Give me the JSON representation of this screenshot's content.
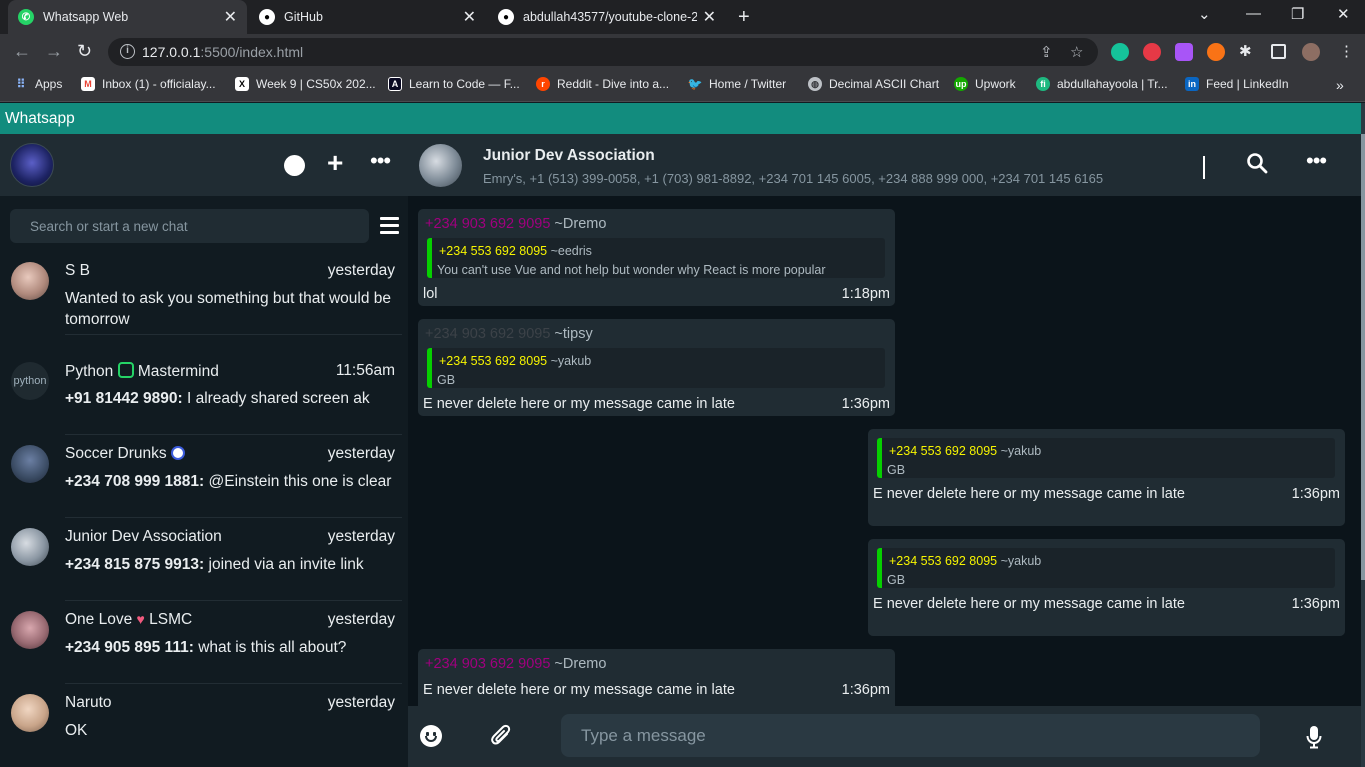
{
  "browser": {
    "tabs": [
      {
        "title": "Whatsapp Web",
        "close": "✕"
      },
      {
        "title": "GitHub",
        "close": "✕"
      },
      {
        "title": "abdullah43577/youtube-clone-2022",
        "close": "✕"
      }
    ],
    "new_tab": "+",
    "url_host": "127.0.0.1",
    "url_rest": ":5500/index.html",
    "bookmarks": [
      {
        "label": "Apps",
        "icon": "apps-grid-icon",
        "color": "#e8eaed"
      },
      {
        "label": "Inbox (1) - officialay...",
        "icon": "gmail-icon",
        "color": "#ea4335"
      },
      {
        "label": "Week 9 | CS50x 202...",
        "icon": "cs50-icon",
        "color": "#000000"
      },
      {
        "label": "Learn to Code — F...",
        "icon": "freecodecamp-icon",
        "color": "#0a0a23"
      },
      {
        "label": "Reddit - Dive into a...",
        "icon": "reddit-icon",
        "color": "#ff4500"
      },
      {
        "label": "Home / Twitter",
        "icon": "twitter-icon",
        "color": "#1d9bf0"
      },
      {
        "label": "Decimal ASCII Chart",
        "icon": "globe-icon",
        "color": "#bdc1c6"
      },
      {
        "label": "Upwork",
        "icon": "upwork-icon",
        "color": "#14a800"
      },
      {
        "label": "abdullahayoola | Tr...",
        "icon": "tr-icon",
        "color": "#1eb980"
      },
      {
        "label": "Feed | LinkedIn",
        "icon": "linkedin-icon",
        "color": "#0a66c2"
      }
    ]
  },
  "app": {
    "title": "Whatsapp",
    "search_placeholder": "Search or start a new chat",
    "chats": [
      {
        "name": "S B",
        "time": "yesterday",
        "sender": "",
        "preview": "Wanted to ask you something but that would be tomorrow",
        "avatar_color": "#c9a79b"
      },
      {
        "name": "Python",
        "name_suffix": "Mastermind",
        "name_emoji": "python-emoji-icon",
        "time": "11:56am",
        "sender": "+91 81442 9890:",
        "preview": "I already shared screen ak",
        "avatar_color": "#1f2a30"
      },
      {
        "name": "Soccer Drunks",
        "name_emoji": "soccer-ball-icon",
        "time": "yesterday",
        "sender": "+234 708 999 1881:",
        "preview": "@Einstein this one is clear",
        "avatar_color": "#3a4b63"
      },
      {
        "name": "Junior Dev Association",
        "time": "yesterday",
        "sender": "+234 815 875 9913:",
        "preview": "joined via an invite link",
        "avatar_color": "#8b97a3"
      },
      {
        "name": "One Love",
        "name_suffix": "LSMC",
        "name_emoji": "heart-emoji-icon",
        "time": "yesterday",
        "sender": "+234 905 895 111:",
        "preview": "what is this all about?",
        "avatar_color": "#9a6b73"
      },
      {
        "name": "Naruto",
        "time": "yesterday",
        "sender": "",
        "preview": "OK",
        "avatar_color": "#c9a58a"
      }
    ],
    "conversation": {
      "name": "Junior Dev Association",
      "members": "Emry's, +1 (513) 399-0058, +1 (703) 981-8892, +234 701 145 6005, +234 888 999 000, +234 701 145 6165",
      "messages": [
        {
          "sender_num": "+234 903 692 9095",
          "sender_nick": "~Dremo",
          "quote_num": "+234 553 692 8095",
          "quote_nick": "~eedris",
          "quote_text": "You can't use Vue and not help but wonder why React is more popular",
          "text": "lol",
          "time": "1:18pm"
        },
        {
          "sender_num": "+234 903 692 9095",
          "sender_nick": "~tipsy",
          "quote_num": "+234 553 692 8095",
          "quote_nick": "~yakub",
          "quote_text": "GB",
          "text": "E never delete here or my message came in late",
          "time": "1:36pm"
        },
        {
          "sender_num": "",
          "sender_nick": "",
          "quote_num": "+234 553 692 8095",
          "quote_nick": "~yakub",
          "quote_text": "GB",
          "text": "E never delete here or my message came in late",
          "time": "1:36pm"
        },
        {
          "sender_num": "",
          "sender_nick": "",
          "quote_num": "+234 553 692 8095",
          "quote_nick": "~yakub",
          "quote_text": "GB",
          "text": "E never delete here or my message came in late",
          "time": "1:36pm"
        },
        {
          "sender_num": "+234 903 692 9095",
          "sender_nick": "~Dremo",
          "quote_num": "",
          "quote_nick": "",
          "quote_text": "",
          "text": "E never delete here or my message came in late",
          "time": "1:36pm"
        }
      ],
      "input_placeholder": "Type a message"
    }
  },
  "colors": {
    "brand": "#128c7e",
    "sender_purple": "#a0007f",
    "quote_yellow": "#f7f500",
    "quote_bar_green": "#06cf00"
  }
}
